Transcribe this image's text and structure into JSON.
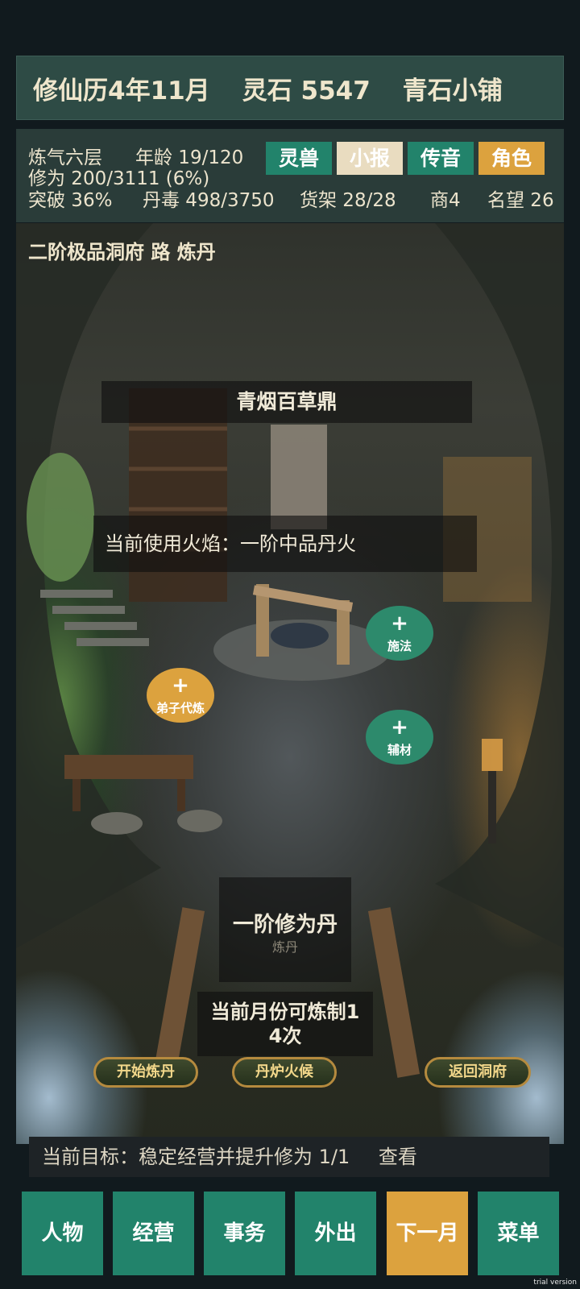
{
  "top_bar": {
    "date": "修仙历4年11月",
    "spirit_stones": "灵石 5547",
    "shop": "青石小铺"
  },
  "status": {
    "realm": "炼气六层",
    "age": "年龄 19/120",
    "cultivation": "修为 200/3111 (6%)",
    "breakthrough": "突破 36%",
    "poison": "丹毒 498/3750",
    "shelves": "货架 28/28",
    "merchant": "商4",
    "reputation": "名望 26",
    "buttons": {
      "spirit_beast": "灵兽",
      "news": "小报",
      "message": "传音",
      "character": "角色"
    }
  },
  "scene": {
    "location": "二阶极品洞府 路 炼丹",
    "furnace": "青烟百草鼎",
    "flame": "当前使用火焰：一阶中品丹火",
    "actions": {
      "cast": "施法",
      "disciple": "弟子代炼",
      "auxiliary": "辅材"
    },
    "plus": "+",
    "recipe": "一阶修为丹",
    "recipe_sub": "炼丹",
    "monthly_limit": "当前月份可炼制14次",
    "buttons": {
      "start": "开始炼丹",
      "fire": "丹炉火候",
      "return": "返回洞府"
    }
  },
  "goal": {
    "text": "当前目标：稳定经营并提升修为 1/1",
    "view": "查看"
  },
  "nav": [
    "人物",
    "经营",
    "事务",
    "外出",
    "下一月",
    "菜单"
  ],
  "watermark": "trial version",
  "colors": {
    "green": "#22836b",
    "orange": "#dca23e",
    "cream": "#e9dcc0",
    "panel": "#2e4b45"
  }
}
